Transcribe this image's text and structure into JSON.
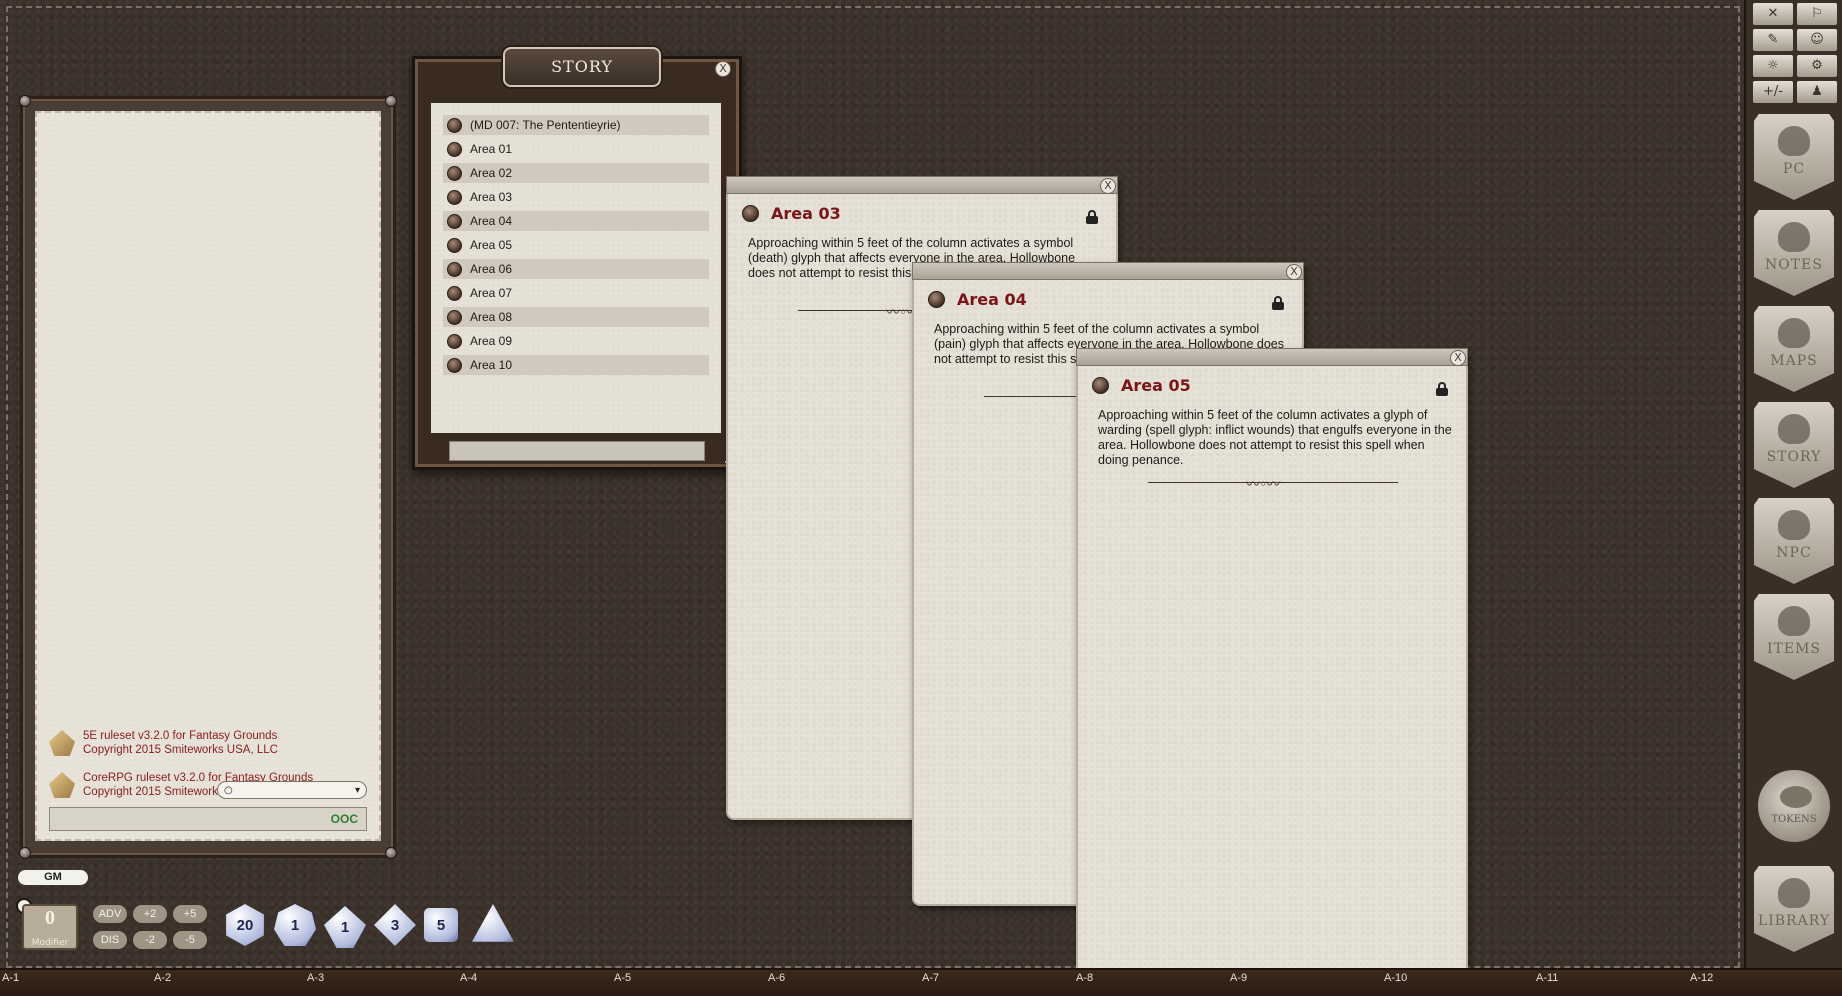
{
  "chat": {
    "messages": [
      {
        "line1": "5E ruleset v3.2.0 for Fantasy Grounds",
        "line2": "Copyright 2015 Smiteworks USA, LLC"
      },
      {
        "line1": "CoreRPG ruleset v3.2.0 for Fantasy Grounds",
        "line2": "Copyright 2015 Smiteworks USA, LLC"
      }
    ],
    "mode_icon": "speech-bubble-icon",
    "ooc_label": "OOC"
  },
  "gm": {
    "label": "GM"
  },
  "modifier": {
    "value": "0",
    "label": "Modifier"
  },
  "mod_buttons": {
    "adv": "ADV",
    "dis": "DIS",
    "plus2": "+2",
    "minus2": "-2",
    "plus5": "+5",
    "minus5": "-5"
  },
  "dice": [
    "d20",
    "d12",
    "d10",
    "d8",
    "d6",
    "d4"
  ],
  "dice_faces": [
    "20",
    "1",
    "1",
    "3",
    "5",
    ""
  ],
  "story": {
    "title": "STORY",
    "close": "X",
    "items": [
      "(MD 007: The Pententieyrie)",
      "Area 01",
      "Area 02",
      "Area 03",
      "Area 04",
      "Area 05",
      "Area 06",
      "Area 07",
      "Area 08",
      "Area 09",
      "Area 10"
    ]
  },
  "records": [
    {
      "title": "Area 03",
      "text": "Approaching within 5 feet of the column activates a symbol (death) glyph that affects everyone in the area. Hollowbone does not attempt to resist this spell when doing penance.",
      "close": "X"
    },
    {
      "title": "Area 04",
      "text": "Approaching within 5 feet of the column activates a symbol (pain) glyph that affects everyone in the area. Hollowbone does not attempt to resist this spell when doing penance.",
      "close": "X"
    },
    {
      "title": "Area 05",
      "text": "Approaching within 5 feet of the column activates a glyph of warding (spell glyph: inflict wounds) that engulfs everyone in the area. Hollowbone does not attempt to resist this spell when doing penance.",
      "close": "X"
    }
  ],
  "sidebar": {
    "tools": [
      "✕",
      "⚐",
      "✎",
      "☺",
      "☼",
      "⚙",
      "+/-",
      "♟"
    ],
    "shields": [
      "PC",
      "NOTES",
      "MAPS",
      "STORY",
      "NPC",
      "ITEMS"
    ],
    "tokens": "TOKENS",
    "library": "LIBRARY"
  },
  "ruler": [
    "A-1",
    "A-2",
    "A-3",
    "A-4",
    "A-5",
    "A-6",
    "A-7",
    "A-8",
    "A-9",
    "A-10",
    "A-11",
    "A-12"
  ],
  "colors": {
    "record_title": "#7a1419",
    "chat_text": "#8a1c1c",
    "ooc": "#2e7d32"
  }
}
